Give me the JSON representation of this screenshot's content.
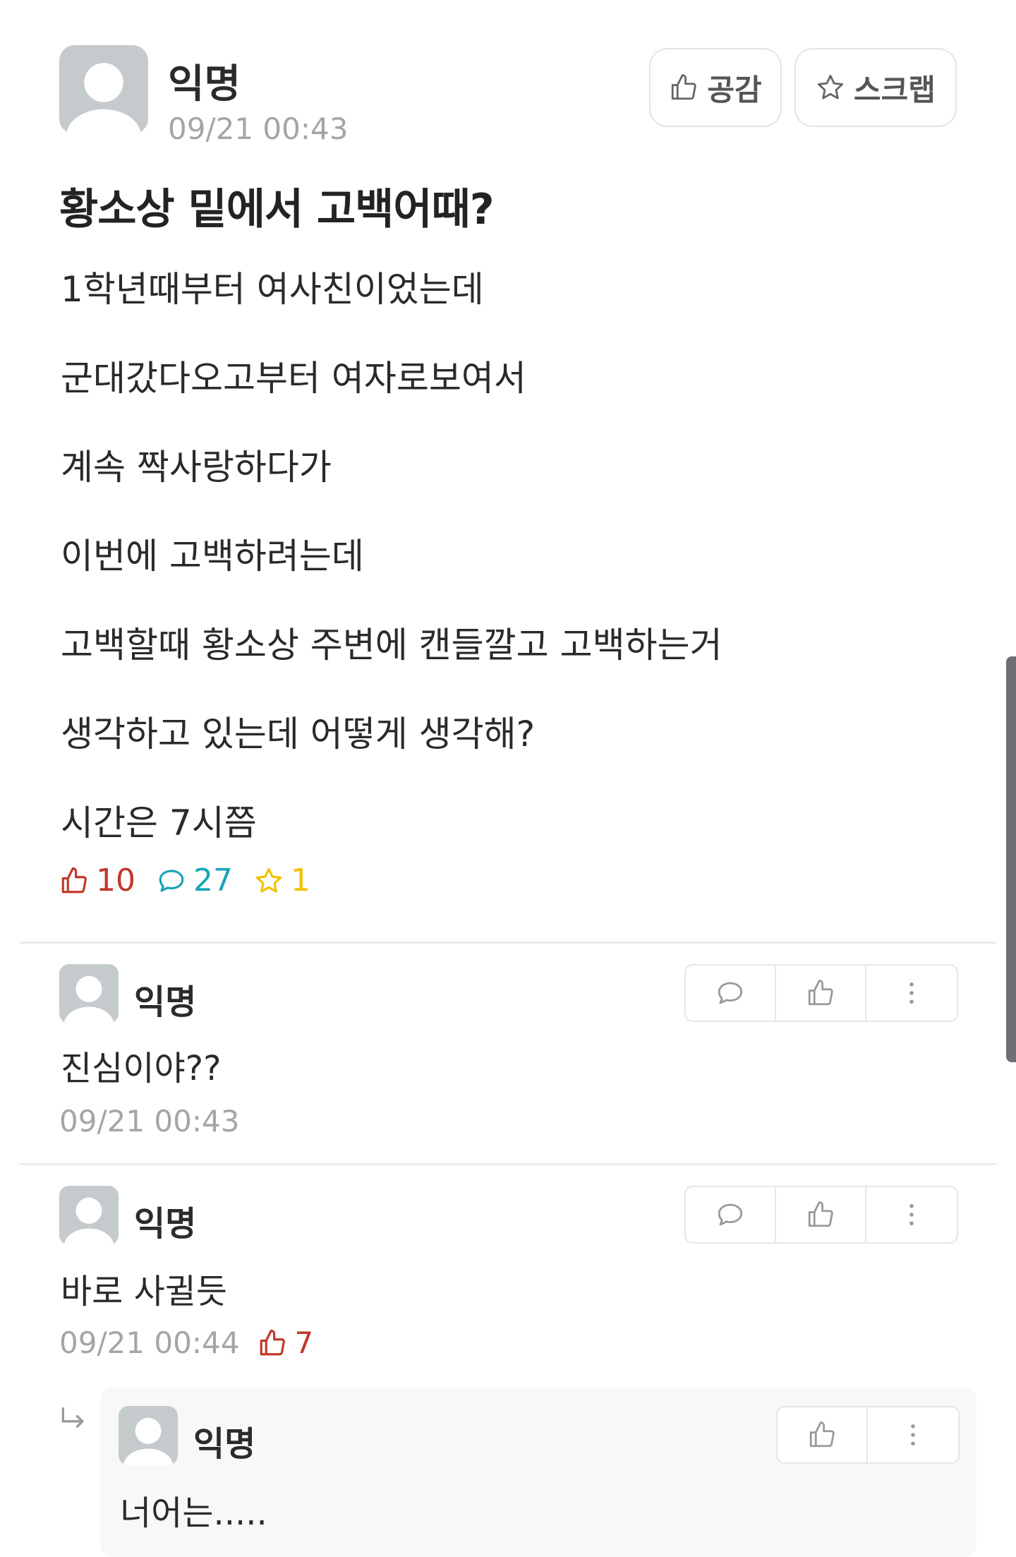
{
  "post": {
    "author": "익명",
    "time": "09/21 00:43",
    "buttons": {
      "like_label": "공감",
      "scrap_label": "스크랩"
    },
    "title": "황소상 밑에서 고백어때?",
    "body_lines": [
      "1학년때부터 여사친이었는데",
      "군대갔다오고부터 여자로보여서",
      "계속 짝사랑하다가",
      "이번에 고백하려는데",
      "고백할때 황소상 주변에 캔들깔고 고백하는거",
      "생각하고 있는데 어떻게 생각해?",
      "시간은 7시쯤"
    ],
    "stats": {
      "likes": "10",
      "comments": "27",
      "scraps": "1"
    }
  },
  "comments": [
    {
      "author": "익명",
      "text": "진심이야??",
      "time": "09/21 00:43"
    },
    {
      "author": "익명",
      "text": "바로 사귈듯",
      "time": "09/21 00:44",
      "likes": "7"
    }
  ],
  "reply": {
    "author": "익명",
    "text": "너어는....."
  },
  "colors": {
    "like": "#c0392b",
    "comment": "#1aa3b8",
    "scrap": "#f2c100",
    "muted": "#a5a5a5"
  },
  "icons": [
    "avatar-icon",
    "thumbs-up-icon",
    "star-icon",
    "speech-bubble-icon",
    "more-vertical-icon",
    "reply-arrow-icon"
  ]
}
